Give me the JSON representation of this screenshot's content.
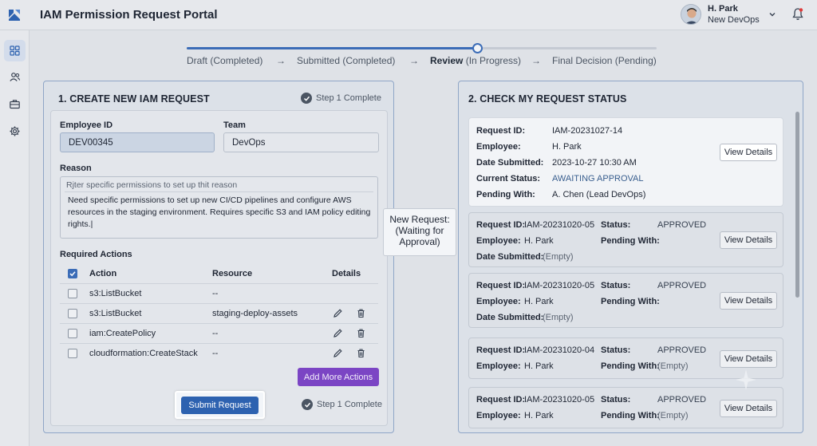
{
  "header": {
    "app_title": "IAM Permission Request Portal",
    "user_name": "H. Park",
    "user_team": "New DevOps"
  },
  "sidebar": {
    "items": [
      {
        "name": "dashboard",
        "icon": "grid-icon",
        "active": true
      },
      {
        "name": "users",
        "icon": "users-icon",
        "active": false
      },
      {
        "name": "requests",
        "icon": "briefcase-icon",
        "active": false
      },
      {
        "name": "settings",
        "icon": "gear-icon",
        "active": false
      }
    ]
  },
  "progress": {
    "fill_fraction": 0.62,
    "steps": [
      {
        "label": "Draft",
        "state": "(Completed)"
      },
      {
        "label": "Submitted",
        "state": "(Completed)"
      },
      {
        "label": "Review",
        "state": "(In Progress)"
      },
      {
        "label": "Final Decision",
        "state": "(Pending)"
      }
    ],
    "arrow": "→"
  },
  "create_panel": {
    "title": "1. CREATE NEW IAM REQUEST",
    "step_status_top": "Step 1 Complete",
    "employee_id_label": "Employee ID",
    "employee_id_value": "DEV00345",
    "team_label": "Team",
    "team_value": "DevOps",
    "reason_label": "Reason",
    "reason_placeholder": "Rjter specific permissions to set up thit reason",
    "reason_text": "Need specific permissions to set up new CI/CD pipelines and configure AWS resources in the staging environment. Requires specific S3 and IAM policy editing rights.|",
    "required_actions_label": "Required Actions",
    "table": {
      "headers": {
        "action": "Action",
        "resource": "Resource",
        "details": "Details"
      },
      "rows": [
        {
          "action": "s3:ListBucket",
          "resource": "--",
          "editable": false
        },
        {
          "action": "s3:ListBucket",
          "resource": "staging-deploy-assets",
          "editable": true
        },
        {
          "action": "iam:CreatePolicy",
          "resource": "--",
          "editable": true
        },
        {
          "action": "cloudformation:CreateStack",
          "resource": "--",
          "editable": true
        }
      ]
    },
    "add_more_label": "Add More Actions",
    "submit_label": "Submit Request",
    "step_status_bottom": "Step 1 Complete"
  },
  "callout": {
    "line1": "New Request:",
    "line2": "(Waiting for",
    "line3": "Approval)"
  },
  "status_panel": {
    "title": "2. CHECK MY REQUEST STATUS",
    "labels": {
      "request_id": "Request ID:",
      "employee": "Employee:",
      "date_submitted": "Date Submitted:",
      "current_status": "Current Status:",
      "pending_with": "Pending With:",
      "status": "Status:"
    },
    "view_details_label": "View Details",
    "featured": {
      "request_id": "IAM-20231027-14",
      "employee": "H. Park",
      "date_submitted": "2023-10-27 10:30 AM",
      "current_status": "AWAITING APPROVAL",
      "pending_with": "A. Chen (Lead DevOps)"
    },
    "requests": [
      {
        "request_id": "IAM-20231020-05",
        "status": "APPROVED",
        "employee": "H. Park",
        "pending_with": "",
        "date_submitted": "(Empty)"
      },
      {
        "request_id": "IAM-20231020-05",
        "status": "APPROVED",
        "employee": "H. Park",
        "pending_with": "",
        "date_submitted": "(Empty)"
      },
      {
        "request_id": "IAM-20231020-04",
        "status": "APPROVED",
        "employee": "H. Park",
        "pending_with": "(Empty)"
      },
      {
        "request_id": "IAM-20231020-05",
        "status": "APPROVED",
        "employee": "H. Park",
        "pending_with": "(Empty)"
      }
    ]
  },
  "colors": {
    "accent": "#2d62b0",
    "add_button": "#7b45c4",
    "awaiting": "#3a5f8f"
  }
}
